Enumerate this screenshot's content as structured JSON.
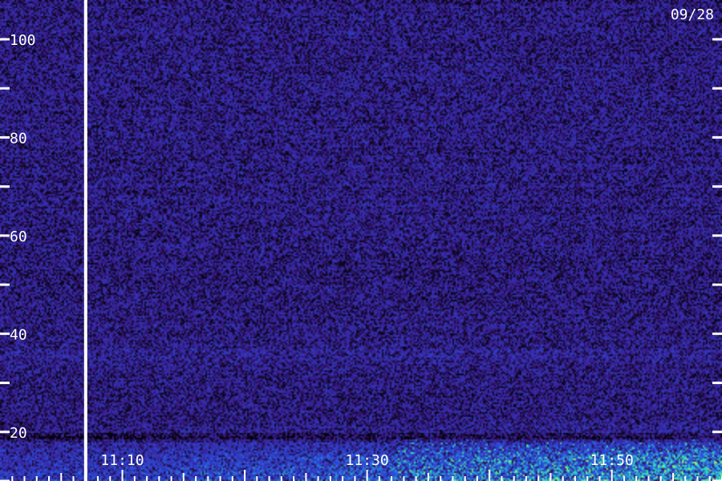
{
  "chart_data": {
    "type": "heatmap",
    "title": "",
    "xlabel": "",
    "ylabel": "",
    "date_label": "09/28",
    "xlim": [
      "11:00",
      "11:59"
    ],
    "ylim": [
      10,
      108
    ],
    "x_ticks": [
      {
        "label": "11:10",
        "value": "11:10"
      },
      {
        "label": "11:30",
        "value": "11:30"
      },
      {
        "label": "11:50",
        "value": "11:50"
      }
    ],
    "y_ticks": [
      {
        "label": "100",
        "value": 100
      },
      {
        "label": "80",
        "value": 80
      },
      {
        "label": "60",
        "value": 60
      },
      {
        "label": "40",
        "value": 40
      },
      {
        "label": "20",
        "value": 20
      }
    ],
    "y_minor_ticks": [
      90,
      70,
      50,
      30,
      10
    ],
    "marker_time": "11:07",
    "colors": {
      "background": "#000000",
      "low": "#3a1a8a",
      "mid": "#2a50e0",
      "high": "#30e8c0",
      "peak": "#a0ff60",
      "axis": "#ffffff"
    },
    "grid": false
  }
}
